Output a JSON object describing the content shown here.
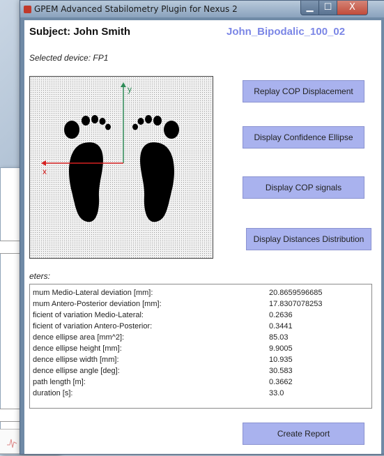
{
  "window": {
    "title": "GPEM Advanced Stabilometry Plugin for Nexus 2",
    "minimize_glyph": "▁",
    "maximize_glyph": "☐",
    "close_glyph": "X"
  },
  "header": {
    "subject": "Subject: John Smith",
    "trial": "John_Bipodalic_100_02",
    "device": "Selected device: FP1"
  },
  "plate": {
    "axis_y_label": "y",
    "axis_x_label": "x",
    "axis_y_color": "#2e8b57",
    "axis_x_color": "#d62020"
  },
  "buttons": {
    "replay": "Replay COP Displacement",
    "ellipse": "Display Confidence Ellipse",
    "signals": "Display COP signals",
    "distances": "Display Distances Distribution",
    "report": "Create Report"
  },
  "params_label": "eters:",
  "params": [
    {
      "label": "mum Medio-Lateral deviation [mm]:",
      "value": "20.8659596685"
    },
    {
      "label": "mum Antero-Posterior deviation [mm]:",
      "value": "17.8307078253"
    },
    {
      "label": "ficient of variation Medio-Lateral:",
      "value": "0.2636"
    },
    {
      "label": "ficient of variation Antero-Posterior:",
      "value": "0.3441"
    },
    {
      "label": "dence ellipse area [mm^2]:",
      "value": "85.03"
    },
    {
      "label": "dence ellipse height [mm]:",
      "value": "9.9005"
    },
    {
      "label": "dence ellipse width [mm]:",
      "value": "10.935"
    },
    {
      "label": "dence ellipse angle [deg]:",
      "value": "30.583"
    },
    {
      "label": " path length [m]:",
      "value": "0.3662"
    },
    {
      "label": "duration [s]:",
      "value": "33.0"
    }
  ],
  "colors": {
    "button_bg": "#a9b2ee",
    "trial_text": "#7b86e6",
    "close_button": "#c14b3a"
  }
}
